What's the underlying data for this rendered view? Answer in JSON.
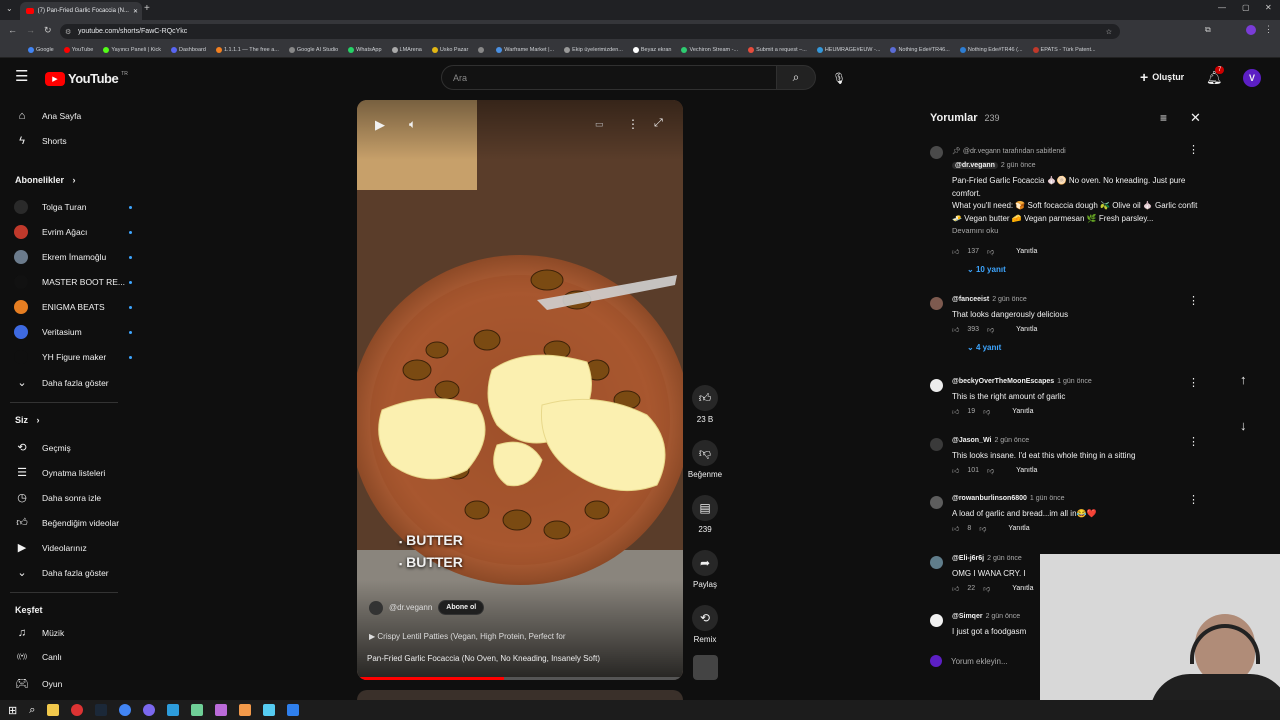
{
  "browser": {
    "tab_title": "(7) Pan-Fried Garlic Focaccia (N...",
    "url": "youtube.com/shorts/FawC-RQcYkc",
    "bookmarks": [
      "Google",
      "YouTube",
      "Yayıncı Paneli | Kick",
      "Dashboard",
      "1.1.1.1 — The free a...",
      "Google AI Studio",
      "WhatsApp",
      "LMArena",
      "Usko Pazar",
      "",
      "Warframe Market |...",
      "Ekip üyelerimizden...",
      "Beyaz ekran",
      "Vechiron Stream -...",
      "Submit a request –...",
      "HEUMRAGE#EUW -...",
      "Nothing Ede#TR46...",
      "Nothing Ede#TR46 (...",
      "EPATS - Türk Patent..."
    ]
  },
  "header": {
    "logo_text": "YouTube",
    "region": "TR",
    "search_placeholder": "Ara",
    "create_label": "Oluştur",
    "notif_count": "7",
    "avatar_letter": "V"
  },
  "sidebar": {
    "home": "Ana Sayfa",
    "shorts": "Shorts",
    "subs_heading": "Abonelikler",
    "subs": [
      {
        "name": "Tolga Turan",
        "color": "#2a2a2a"
      },
      {
        "name": "Evrim Ağacı",
        "color": "#c0392b"
      },
      {
        "name": "Ekrem İmamoğlu",
        "color": "#6b7b8c"
      },
      {
        "name": "MASTER BOOT RE...",
        "color": "#111111"
      },
      {
        "name": "ENIGMA BEATS",
        "color": "#e67e22"
      },
      {
        "name": "Veritasium",
        "color": "#3e6ae1"
      },
      {
        "name": "YH Figure maker",
        "color": "#0f0f0f"
      }
    ],
    "show_more_1": "Daha fazla göster",
    "you_heading": "Siz",
    "you_items": [
      "Geçmiş",
      "Oynatma listeleri",
      "Daha sonra izle",
      "Beğendiğim videolar",
      "Videolarınız"
    ],
    "show_more_2": "Daha fazla göster",
    "explore_heading": "Keşfet",
    "explore_items": [
      "Müzik",
      "Canlı",
      "Oyun"
    ]
  },
  "video": {
    "overlay_line1": "BUTTER",
    "overlay_line2": "BUTTER",
    "channel": "@dr.vegann",
    "subscribe": "Abone ol",
    "playlist": "Crispy Lentil Patties (Vegan, High Protein, Perfect for",
    "title": "Pan-Fried Garlic Focaccia (No Oven, No Kneading, Insanely Soft)",
    "progress": 0.45
  },
  "actions": {
    "likes": "23 B",
    "dislike": "Beğenme",
    "comments": "239",
    "share": "Paylaş",
    "remix": "Remix"
  },
  "comments": {
    "title": "Yorumlar",
    "count": "239",
    "pinned_by": "@dr.vegann tarafından sabitlendi",
    "items": [
      {
        "author": "@dr.vegann",
        "time": "2 gün önce",
        "text": "Pan-Fried Garlic Focaccia 🧄🫓 No oven. No kneading. Just pure comfort.",
        "text2": "What you'll need: 🍞 Soft focaccia dough 🫒 Olive oil 🧄 Garlic confit 🧈 Vegan butter 🧀 Vegan parmesan 🌿 Fresh parsley...",
        "more": "Devamını oku",
        "likes": "137",
        "reply": "Yanıtla",
        "replies": "10 yanıt",
        "color": "#4a4a4a"
      },
      {
        "author": "@fanceeist",
        "time": "2 gün önce",
        "text": "That looks dangerously delicious",
        "likes": "393",
        "reply": "Yanıtla",
        "replies": "4 yanıt",
        "color": "#7d5a4f"
      },
      {
        "author": "@beckyOverTheMoonEscapes",
        "time": "1 gün önce",
        "text": "This is the right amount of garlic",
        "likes": "19",
        "reply": "Yanıtla",
        "color": "#ececec"
      },
      {
        "author": "@Jason_Wi",
        "time": "2 gün önce",
        "text": "This looks insane. I'd eat this whole thing in a sitting",
        "likes": "101",
        "reply": "Yanıtla",
        "color": "#3a3a3a"
      },
      {
        "author": "@rowanburlinson6800",
        "time": "1 gün önce",
        "text": "A load of garlic and bread...im all in😂❤️",
        "likes": "8",
        "reply": "Yanıtla",
        "color": "#5d5d5d"
      },
      {
        "author": "@Eli-j6r6j",
        "time": "2 gün önce",
        "text": "OMG I WANA CRY. I WA",
        "likes": "22",
        "reply": "Yanıtla",
        "color": "#607d8b"
      },
      {
        "author": "@Simqer",
        "time": "2 gün önce",
        "text": "I just got a foodgasm ju",
        "color": "#f1f1f1"
      }
    ],
    "add_placeholder": "Yorum ekleyin..."
  }
}
